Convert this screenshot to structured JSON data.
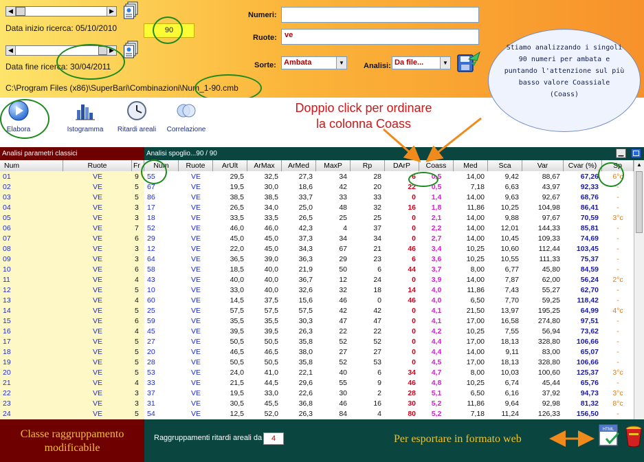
{
  "top": {
    "start_date_label": "Data inizio ricerca: 05/10/2010",
    "end_date_label": "Data fine ricerca: 30/04/2011",
    "count_box": "90",
    "file_path": "C:\\Program Files (x86)\\SuperBari\\Combinazioni\\Num_1-90.cmb",
    "numeri_label": "Numeri:",
    "numeri_value": "",
    "ruote_label": "Ruote:",
    "ruote_value": "ve",
    "sorte_label": "Sorte:",
    "sorte_value": "Ambata",
    "analisi_label": "Analisi:",
    "analisi_value": "Da file..."
  },
  "toolbar": {
    "elabora": "Elabora",
    "istogramma": "Istogramma",
    "ritardi": "Ritardi areali",
    "correlazione": "Correlazione"
  },
  "annotations": {
    "double_click_line1": "Doppio click per ordinare",
    "double_click_line2": "la colonna Coass",
    "bubble": "Stiamo analizzando i singoli 90 numeri per ambata e puntando l'attenzione sul più basso valore Coassiale (Coass)",
    "group_line1": "Classe raggruppamento",
    "group_line2": "modificabile",
    "export": "Per esportare in formato web"
  },
  "left_panel": {
    "title": "Analisi parametri classici",
    "headers": [
      "Num",
      "Ruote",
      "Fr"
    ],
    "rows": [
      [
        "01",
        "VE",
        "9"
      ],
      [
        "02",
        "VE",
        "5"
      ],
      [
        "03",
        "VE",
        "5"
      ],
      [
        "04",
        "VE",
        "3"
      ],
      [
        "05",
        "VE",
        "3"
      ],
      [
        "06",
        "VE",
        "7"
      ],
      [
        "07",
        "VE",
        "6"
      ],
      [
        "08",
        "VE",
        "3"
      ],
      [
        "09",
        "VE",
        "3"
      ],
      [
        "10",
        "VE",
        "6"
      ],
      [
        "11",
        "VE",
        "4"
      ],
      [
        "12",
        "VE",
        "5"
      ],
      [
        "13",
        "VE",
        "4"
      ],
      [
        "14",
        "VE",
        "5"
      ],
      [
        "15",
        "VE",
        "6"
      ],
      [
        "16",
        "VE",
        "4"
      ],
      [
        "17",
        "VE",
        "5"
      ],
      [
        "18",
        "VE",
        "5"
      ],
      [
        "19",
        "VE",
        "5"
      ],
      [
        "20",
        "VE",
        "5"
      ],
      [
        "21",
        "VE",
        "4"
      ],
      [
        "22",
        "VE",
        "3"
      ],
      [
        "23",
        "VE",
        "3"
      ],
      [
        "24",
        "VE",
        "5"
      ]
    ]
  },
  "right_panel": {
    "title": "Analisi spoglio...90 / 90",
    "headers": [
      "Num",
      "Ruote",
      "ArUlt",
      "ArMax",
      "ArMed",
      "MaxP",
      "Rp",
      "DArP",
      "Coass",
      "Med",
      "Sca",
      "Var",
      "Cvar (%)",
      "Sp"
    ],
    "rows": [
      [
        "55",
        "VE",
        "29,5",
        "32,5",
        "27,3",
        "34",
        "28",
        "6",
        "0,5",
        "14,00",
        "9,42",
        "88,67",
        "67,26",
        "6°c"
      ],
      [
        "67",
        "VE",
        "19,5",
        "30,0",
        "18,6",
        "42",
        "20",
        "22",
        "0,5",
        "7,18",
        "6,63",
        "43,97",
        "92,33",
        "-"
      ],
      [
        "86",
        "VE",
        "38,5",
        "38,5",
        "33,7",
        "33",
        "33",
        "0",
        "1,4",
        "14,00",
        "9,63",
        "92,67",
        "68,76",
        "-"
      ],
      [
        "17",
        "VE",
        "26,5",
        "34,0",
        "25,0",
        "48",
        "32",
        "16",
        "1,8",
        "11,86",
        "10,25",
        "104,98",
        "86,41",
        "-"
      ],
      [
        "18",
        "VE",
        "33,5",
        "33,5",
        "26,5",
        "25",
        "25",
        "0",
        "2,1",
        "14,00",
        "9,88",
        "97,67",
        "70,59",
        "3°c"
      ],
      [
        "52",
        "VE",
        "46,0",
        "46,0",
        "42,3",
        "4",
        "37",
        "0",
        "2,2",
        "14,00",
        "12,01",
        "144,33",
        "85,81",
        "-"
      ],
      [
        "29",
        "VE",
        "45,0",
        "45,0",
        "37,3",
        "34",
        "34",
        "0",
        "2,7",
        "14,00",
        "10,45",
        "109,33",
        "74,69",
        "-"
      ],
      [
        "12",
        "VE",
        "22,0",
        "45,0",
        "34,3",
        "67",
        "21",
        "46",
        "3,4",
        "10,25",
        "10,60",
        "112,44",
        "103,45",
        "-"
      ],
      [
        "64",
        "VE",
        "36,5",
        "39,0",
        "36,3",
        "29",
        "23",
        "6",
        "3,6",
        "10,25",
        "10,55",
        "111,33",
        "75,37",
        "-"
      ],
      [
        "58",
        "VE",
        "18,5",
        "40,0",
        "21,9",
        "50",
        "6",
        "44",
        "3,7",
        "8,00",
        "6,77",
        "45,80",
        "84,59",
        "-"
      ],
      [
        "43",
        "VE",
        "40,0",
        "40,0",
        "36,7",
        "12",
        "24",
        "0",
        "3,9",
        "14,00",
        "7,87",
        "62,00",
        "56,24",
        "2°c"
      ],
      [
        "10",
        "VE",
        "33,0",
        "40,0",
        "32,6",
        "32",
        "18",
        "14",
        "4,0",
        "11,86",
        "7,43",
        "55,27",
        "62,70",
        "-"
      ],
      [
        "60",
        "VE",
        "14,5",
        "37,5",
        "15,6",
        "46",
        "0",
        "46",
        "4,0",
        "6,50",
        "7,70",
        "59,25",
        "118,42",
        "-"
      ],
      [
        "25",
        "VE",
        "57,5",
        "57,5",
        "57,5",
        "42",
        "42",
        "0",
        "4,1",
        "21,50",
        "13,97",
        "195,25",
        "64,99",
        "4°c"
      ],
      [
        "59",
        "VE",
        "35,5",
        "35,5",
        "30,3",
        "47",
        "47",
        "0",
        "4,1",
        "17,00",
        "16,58",
        "274,80",
        "97,51",
        "-"
      ],
      [
        "45",
        "VE",
        "39,5",
        "39,5",
        "26,3",
        "22",
        "22",
        "0",
        "4,2",
        "10,25",
        "7,55",
        "56,94",
        "73,62",
        "-"
      ],
      [
        "27",
        "VE",
        "50,5",
        "50,5",
        "35,8",
        "52",
        "52",
        "0",
        "4,4",
        "17,00",
        "18,13",
        "328,80",
        "106,66",
        "-"
      ],
      [
        "20",
        "VE",
        "46,5",
        "46,5",
        "38,0",
        "27",
        "27",
        "0",
        "4,4",
        "14,00",
        "9,11",
        "83,00",
        "65,07",
        "-"
      ],
      [
        "28",
        "VE",
        "50,5",
        "50,5",
        "35,8",
        "52",
        "53",
        "0",
        "4,5",
        "17,00",
        "18,13",
        "328,80",
        "106,66",
        "-"
      ],
      [
        "53",
        "VE",
        "24,0",
        "41,0",
        "22,1",
        "40",
        "6",
        "34",
        "4,7",
        "8,00",
        "10,03",
        "100,60",
        "125,37",
        "3°c"
      ],
      [
        "33",
        "VE",
        "21,5",
        "44,5",
        "29,6",
        "55",
        "9",
        "46",
        "4,8",
        "10,25",
        "6,74",
        "45,44",
        "65,76",
        "-"
      ],
      [
        "37",
        "VE",
        "19,5",
        "33,0",
        "22,6",
        "30",
        "2",
        "28",
        "5,1",
        "6,50",
        "6,16",
        "37,92",
        "94,73",
        "3°c"
      ],
      [
        "31",
        "VE",
        "30,5",
        "45,5",
        "36,8",
        "46",
        "16",
        "30",
        "5,2",
        "11,86",
        "9,64",
        "92,98",
        "81,32",
        "8°c"
      ],
      [
        "54",
        "VE",
        "12,5",
        "52,0",
        "26,3",
        "84",
        "4",
        "80",
        "5,2",
        "7,18",
        "11,24",
        "126,33",
        "156,50",
        "-"
      ]
    ]
  },
  "footer": {
    "group_label": "Raggruppamenti ritardi areali da",
    "group_value": "4"
  }
}
